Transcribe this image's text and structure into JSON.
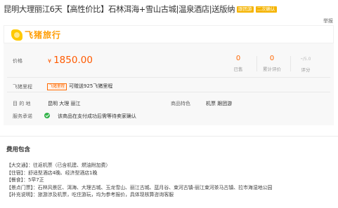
{
  "title": "昆明大理丽江6天【高性价比】石林洱海+雪山古城|温泉酒店|送版纳",
  "tags": [
    "跟团游",
    "二次确认"
  ],
  "report_label": "举报",
  "brand": {
    "name": "飞猪旅行",
    "color": "#ff9c00",
    "logo_color": "#ffc900"
  },
  "price": {
    "label": "价格",
    "currency": "¥",
    "value": "1850.00",
    "color": "#ff5a00"
  },
  "stats": [
    {
      "value": "0",
      "label": "已售"
    },
    {
      "value": "0",
      "label": "累计评价"
    },
    {
      "value": "-",
      "sub": "/5.0",
      "label": "评分"
    }
  ],
  "points": {
    "label": "飞猪里程",
    "badge": "飞猪里程",
    "text": "可赠送925飞猪里程"
  },
  "destination": {
    "label": "目 的 地",
    "value": "昆明  大理  丽江"
  },
  "features": {
    "label": "商品特色",
    "value": "机票  跟团游"
  },
  "service": {
    "label": "服务承诺",
    "value": "该商品在支付成功后需等待卖家确认"
  },
  "fees": {
    "title": "费用包含",
    "items": [
      "【大交通】：往返机票（已含机建、燃油附加费）",
      "【住宿】：舒适型酒店4晚、经济型酒店1晚",
      "【餐食】：5早7正",
      "【景点门票】：石林风景区、洱海、大理古城、玉龙雪山、丽江古城、蓝月谷、束河古镇-丽江束河茶马古镇、拉市海湿地公园",
      "【补充说明】：旅游涉及机票，吃住游玩，均为参考报价，具体现核算咨询客服"
    ]
  }
}
